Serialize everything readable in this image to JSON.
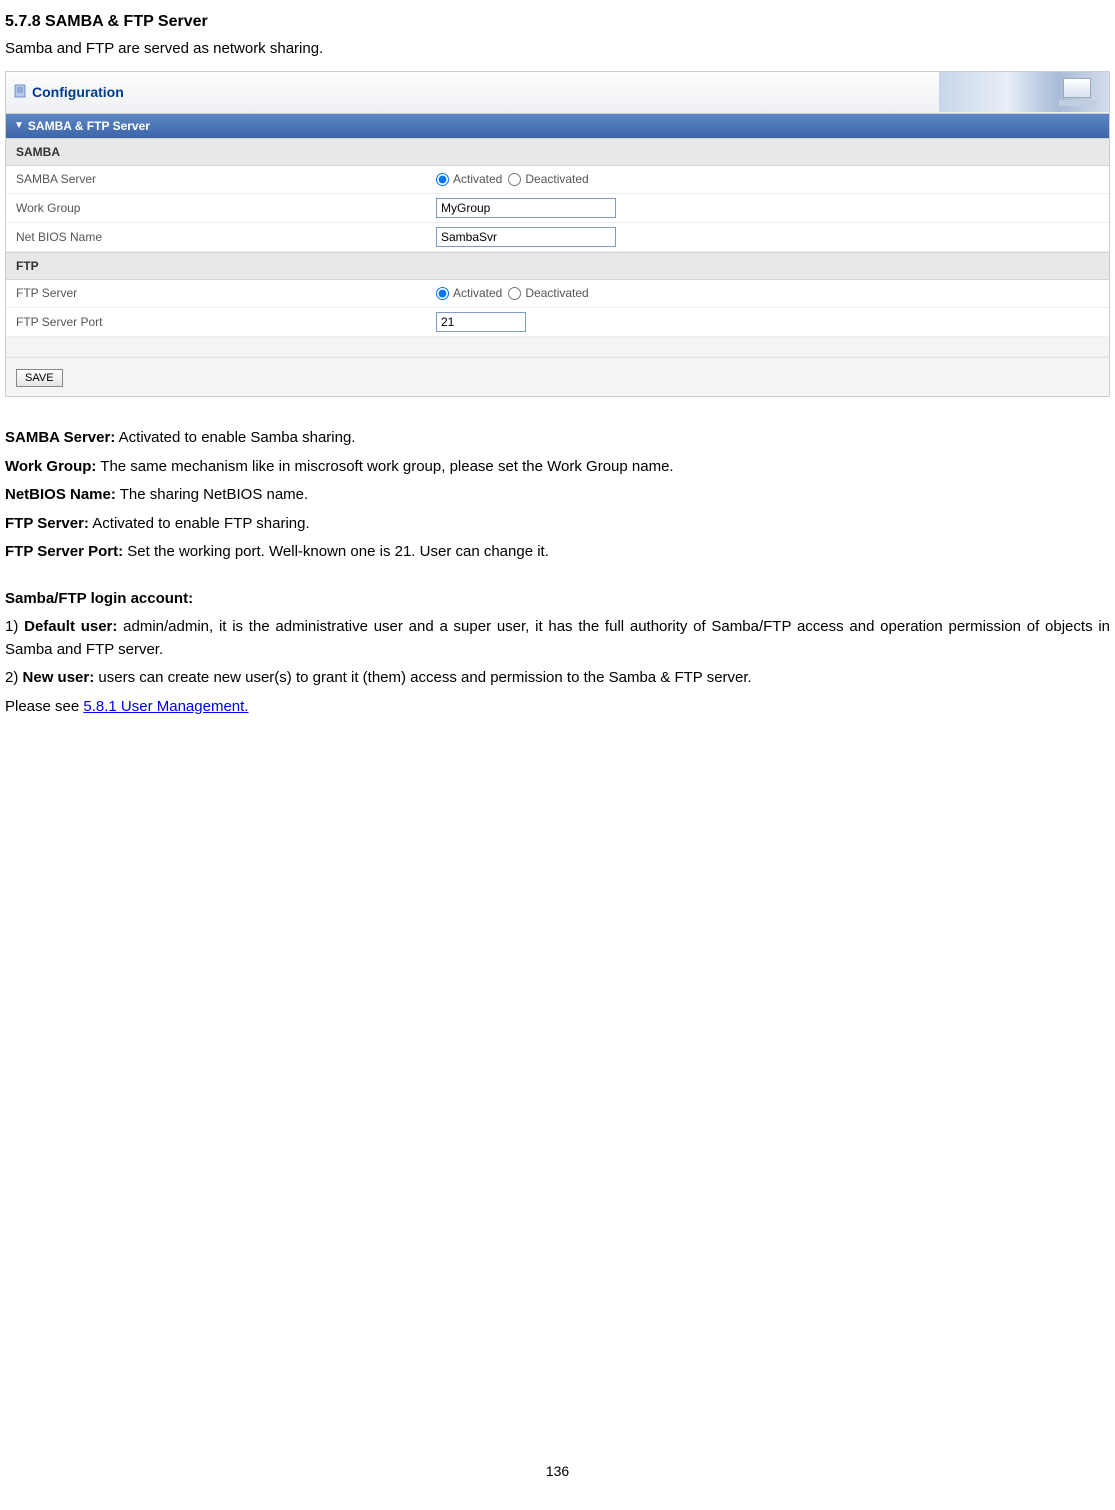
{
  "heading": "5.7.8 SAMBA & FTP Server",
  "intro": "Samba and FTP are served as network sharing.",
  "panel": {
    "headerTitle": "Configuration",
    "sectionTitle": "SAMBA & FTP Server",
    "samba": {
      "header": "SAMBA",
      "serverLabel": "SAMBA Server",
      "activated": "Activated",
      "deactivated": "Deactivated",
      "workGroupLabel": "Work Group",
      "workGroupValue": "MyGroup",
      "netbiosLabel": "Net BIOS Name",
      "netbiosValue": "SambaSvr"
    },
    "ftp": {
      "header": "FTP",
      "serverLabel": "FTP Server",
      "activated": "Activated",
      "deactivated": "Deactivated",
      "portLabel": "FTP Server Port",
      "portValue": "21"
    },
    "saveLabel": "SAVE"
  },
  "desc": {
    "l1b": "SAMBA Server:",
    "l1": " Activated to enable Samba sharing.",
    "l2b": "Work Group:",
    "l2": " The same mechanism like in miscrosoft work group, please set the Work Group name.",
    "l3b": "NetBIOS Name:",
    "l3": " The sharing NetBIOS name.",
    "l4b": "FTP Server:",
    "l4": " Activated to enable FTP sharing.",
    "l5b": "FTP Server Port:",
    "l5": " Set the working port. Well-known one is 21. User can change it.",
    "acctHeader": "Samba/FTP login account:",
    "d1a": "1) ",
    "d1b": "Default user:",
    "d1c": " admin/admin, it is the administrative user and a super user, it has the full authority of Samba/FTP access and operation permission of objects in Samba and FTP server.",
    "d2a": "2) ",
    "d2b": "New user:",
    "d2c": " users can create new user(s) to grant it (them) access and permission to the Samba & FTP server.",
    "seePrefix": " Please see ",
    "seeLink": "5.8.1 User Management."
  },
  "pageNumber": "136"
}
